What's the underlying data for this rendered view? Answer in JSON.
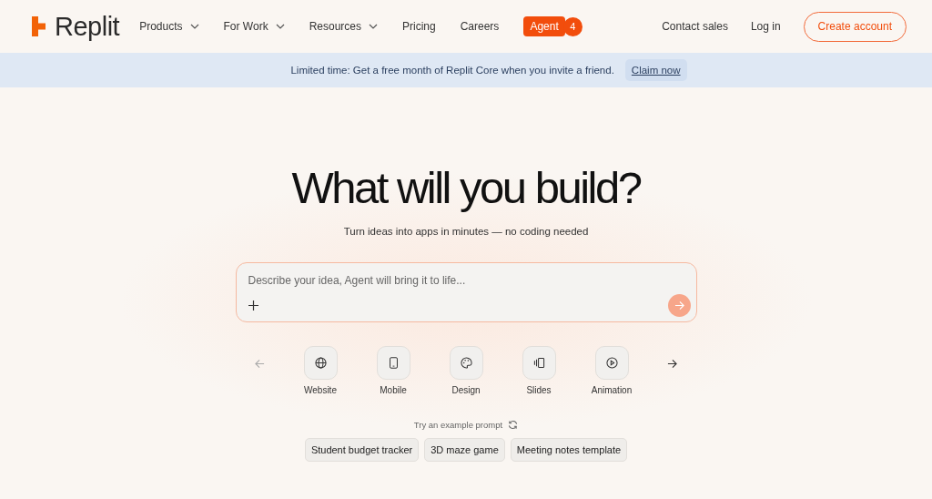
{
  "brand": {
    "name": "Replit"
  },
  "nav": [
    {
      "label": "Products",
      "has_menu": true
    },
    {
      "label": "For Work",
      "has_menu": true
    },
    {
      "label": "Resources",
      "has_menu": true
    },
    {
      "label": "Pricing",
      "has_menu": false
    },
    {
      "label": "Careers",
      "has_menu": false
    }
  ],
  "agent": {
    "label": "Agent",
    "count": "4"
  },
  "header_actions": {
    "contact": "Contact sales",
    "login": "Log in",
    "signup": "Create account"
  },
  "banner": {
    "text": "Limited time: Get a free month of Replit Core when you invite a friend.",
    "link": "Claim now"
  },
  "hero": {
    "title": "What will you build?",
    "subtitle": "Turn ideas into apps in minutes — no coding needed"
  },
  "prompt": {
    "placeholder": "Describe your idea, Agent will bring it to life..."
  },
  "categories": [
    {
      "label": "Website",
      "kind": "globe"
    },
    {
      "label": "Mobile",
      "kind": "phone"
    },
    {
      "label": "Design",
      "kind": "palette"
    },
    {
      "label": "Slides",
      "kind": "slides"
    },
    {
      "label": "Animation",
      "kind": "play"
    }
  ],
  "examples": {
    "label": "Try an example prompt",
    "chips": [
      "Student budget tracker",
      "3D maze game",
      "Meeting notes template"
    ]
  }
}
